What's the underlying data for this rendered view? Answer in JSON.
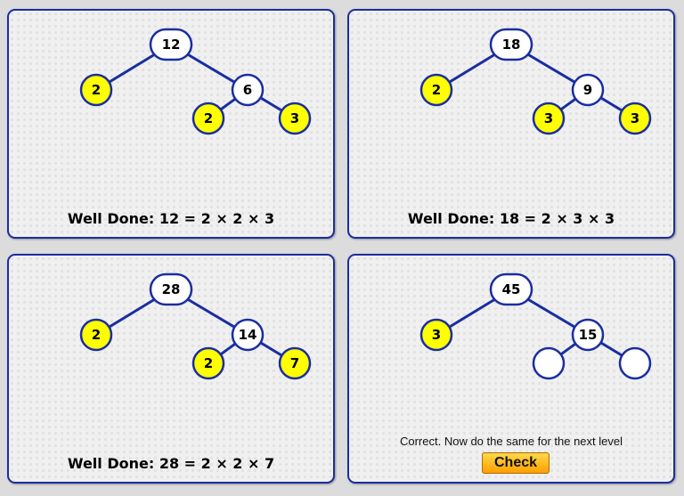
{
  "colors": {
    "accent": "#1a2ea0",
    "factor_fill": "#ffff00",
    "empty_fill": "#ffffff",
    "button": "#ffb000"
  },
  "panels": [
    {
      "root": "12",
      "left": "2",
      "right": "6",
      "right_left": "2",
      "right_right": "3",
      "left_prime": true,
      "right_left_prime": true,
      "right_right_prime": true,
      "result": "Well Done: 12 = 2 × 2 × 3"
    },
    {
      "root": "18",
      "left": "2",
      "right": "9",
      "right_left": "3",
      "right_right": "3",
      "left_prime": true,
      "right_left_prime": true,
      "right_right_prime": true,
      "result": "Well Done: 18 = 2 × 3 × 3"
    },
    {
      "root": "28",
      "left": "2",
      "right": "14",
      "right_left": "2",
      "right_right": "7",
      "left_prime": true,
      "right_left_prime": true,
      "right_right_prime": true,
      "result": "Well Done: 28 = 2 × 2 × 7"
    },
    {
      "root": "45",
      "left": "3",
      "right": "15",
      "right_left": "",
      "right_right": "",
      "left_prime": true,
      "right_left_prime": false,
      "right_right_prime": false,
      "message": "Correct. Now do the same for the next level",
      "check_label": "Check"
    }
  ]
}
